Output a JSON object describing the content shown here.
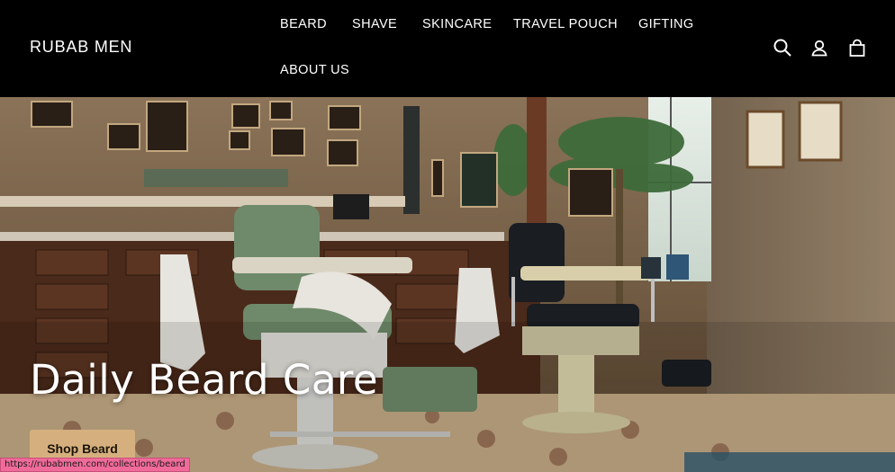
{
  "brand": {
    "name": "RUBAB MEN"
  },
  "nav": {
    "items": [
      {
        "label": "BEARD"
      },
      {
        "label": "SHAVE"
      },
      {
        "label": "SKINCARE"
      },
      {
        "label": "TRAVEL POUCH"
      },
      {
        "label": "GIFTING"
      },
      {
        "label": "ABOUT US"
      }
    ]
  },
  "header_icons": [
    "search-icon",
    "account-icon",
    "cart-icon"
  ],
  "hero": {
    "title": "Daily Beard Care",
    "cta_label": "Shop Beard",
    "image": "barbershop-interior-photo"
  },
  "status_bar": {
    "url": "https://rubabmen.com/collections/beard"
  },
  "colors": {
    "header_bg": "#000000",
    "cta_bg": "#d5b07e",
    "status_bg": "#f06a9a"
  }
}
